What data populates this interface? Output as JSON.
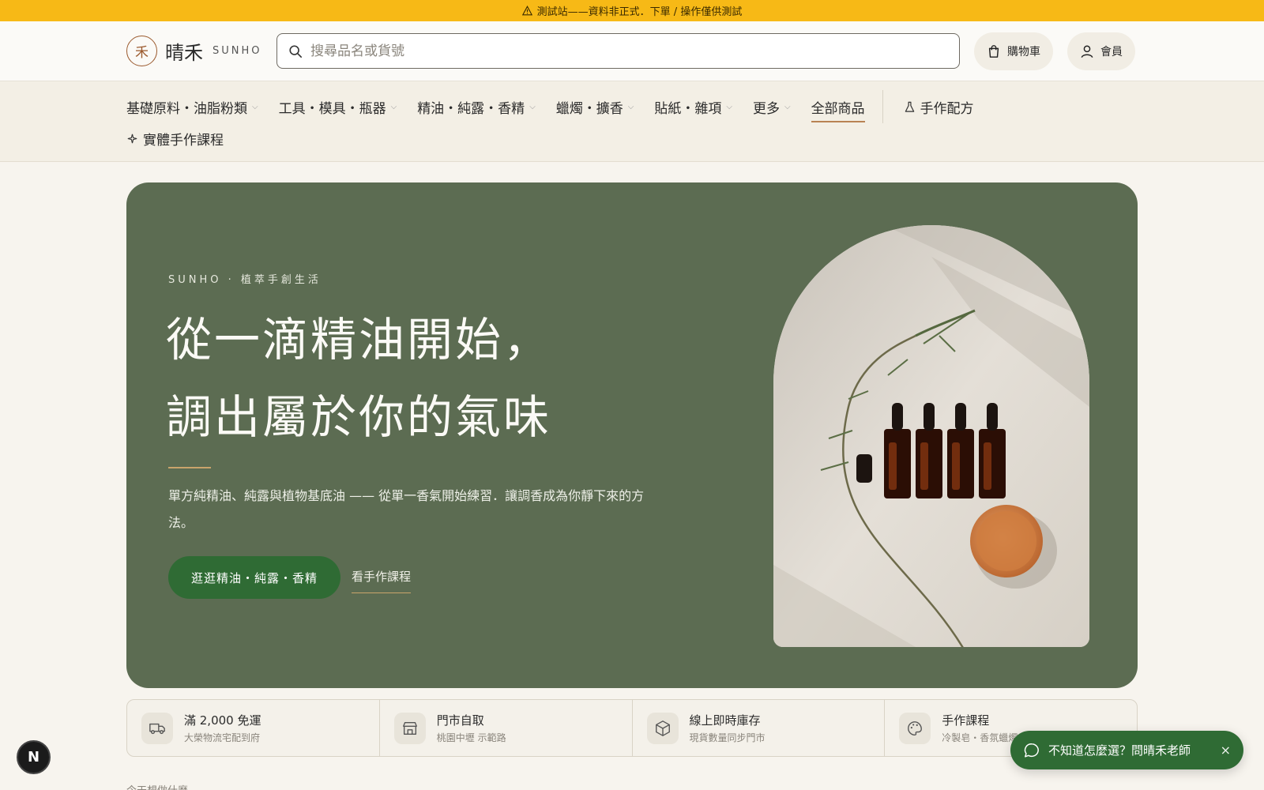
{
  "banner": {
    "text": "測試站——資料非正式．下單 / 操作僅供測試"
  },
  "header": {
    "logo_mark": "禾",
    "logo_cn": "晴禾",
    "logo_en": "SUNHO",
    "search_placeholder": "搜尋品名或貨號",
    "cart_label": "購物車",
    "member_label": "會員"
  },
  "nav": {
    "items": [
      {
        "label": "基礎原料・油脂粉類",
        "dropdown": true
      },
      {
        "label": "工具・模具・瓶器",
        "dropdown": true
      },
      {
        "label": "精油・純露・香精",
        "dropdown": true
      },
      {
        "label": "蠟燭・擴香",
        "dropdown": true
      },
      {
        "label": "貼紙・雜項",
        "dropdown": true
      },
      {
        "label": "更多",
        "dropdown": true
      },
      {
        "label": "全部商品",
        "dropdown": false,
        "active": true
      }
    ],
    "recipes_label": "手作配方",
    "courses_label": "實體手作課程"
  },
  "hero": {
    "eyebrow": "SUNHO · 植萃手創生活",
    "title_line1": "從一滴精油開始，",
    "title_line2": "調出屬於你的氣味",
    "description": "單方純精油、純露與植物基底油 —— 從單一香氣開始練習．讓調香成為你靜下來的方法。",
    "primary_cta": "逛逛精油・純露・香精",
    "secondary_cta": "看手作課程"
  },
  "features": [
    {
      "icon": "truck-icon",
      "title": "滿 2,000 免運",
      "subtitle": "大榮物流宅配到府"
    },
    {
      "icon": "store-icon",
      "title": "門市自取",
      "subtitle": "桃園中壢 示範路"
    },
    {
      "icon": "box-icon",
      "title": "線上即時庫存",
      "subtitle": "現貨數量同步門市"
    },
    {
      "icon": "palette-icon",
      "title": "手作課程",
      "subtitle": "冷製皂・香氛蠟燭"
    }
  ],
  "below_text": "今天想做什麼",
  "badge": {
    "letter": "N"
  },
  "chat": {
    "label": "不知道怎麼選？問晴禾老師",
    "close": "×"
  },
  "colors": {
    "banner": "#f7b916",
    "hero_bg": "#5c6c52",
    "primary": "#2f6b34",
    "accent": "#b98353"
  }
}
